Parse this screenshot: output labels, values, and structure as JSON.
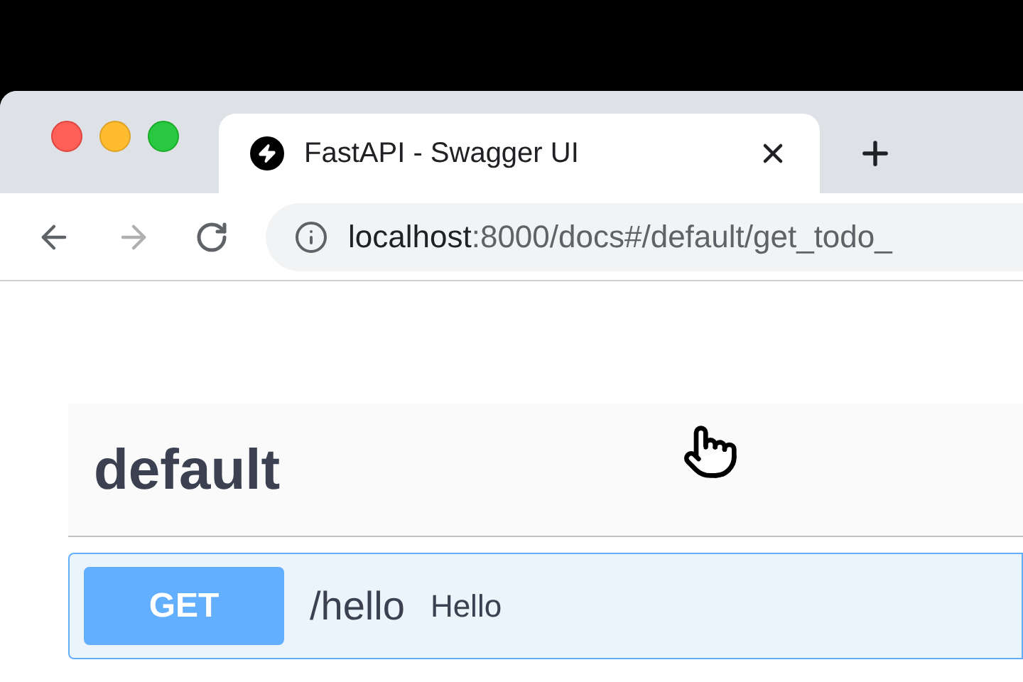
{
  "browser": {
    "tabs": [
      {
        "title": "FastAPI - Swagger UI",
        "selected": true
      }
    ],
    "nav": {
      "back_disabled": false,
      "forward_disabled": true
    },
    "address": {
      "host": "localhost",
      "path": ":8000/docs#/default/get_todo_"
    }
  },
  "section": {
    "title": "default"
  },
  "operations": [
    {
      "method": "GET",
      "path": "/hello",
      "summary": "Hello"
    }
  ]
}
